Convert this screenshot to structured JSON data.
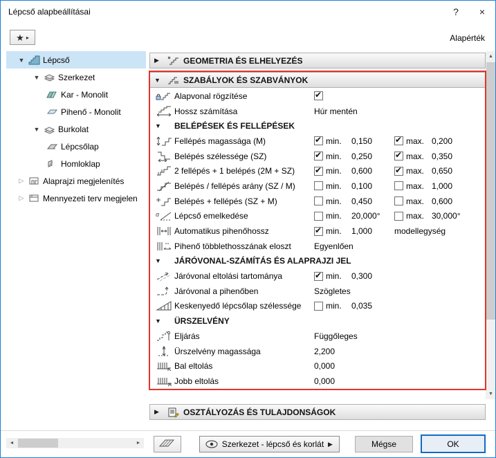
{
  "window": {
    "title": "Lépcső alapbeállításai",
    "default_label": "Alapérték"
  },
  "icons": {
    "help": "?",
    "close": "×",
    "favorites_star": "★",
    "favorites_arrow": "▸",
    "tree_expanded": "▼",
    "tree_collapsed": "▷",
    "section_expanded": "▼",
    "section_collapsed": "▶",
    "subsection_expanded": "▼",
    "scroll_up": "▲",
    "scroll_down": "▼",
    "scroll_left": "◄",
    "scroll_right": "►",
    "dropdown_arrow": "▶"
  },
  "tree": {
    "items": [
      {
        "label": "Lépcső",
        "level": 0,
        "arrow": "expanded",
        "icon": "stair-icon",
        "selected": true
      },
      {
        "label": "Szerkezet",
        "level": 1,
        "arrow": "expanded",
        "icon": "structure-icon",
        "selected": false
      },
      {
        "label": "Kar - Monolit",
        "level": 2,
        "arrow": "none",
        "icon": "flight-icon",
        "selected": false
      },
      {
        "label": "Pihenő - Monolit",
        "level": 2,
        "arrow": "none",
        "icon": "landing-icon",
        "selected": false
      },
      {
        "label": "Burkolat",
        "level": 1,
        "arrow": "expanded",
        "icon": "finish-icon",
        "selected": false
      },
      {
        "label": "Lépcsőlap",
        "level": 2,
        "arrow": "none",
        "icon": "tread-icon",
        "selected": false
      },
      {
        "label": "Homloklap",
        "level": 2,
        "arrow": "none",
        "icon": "riser-icon",
        "selected": false
      },
      {
        "label": "Alaprajzi megjelenítés",
        "level": 0,
        "arrow": "collapsed",
        "icon": "floorplan-icon",
        "selected": false
      },
      {
        "label": "Mennyezeti terv megjelen",
        "level": 0,
        "arrow": "collapsed",
        "icon": "ceiling-icon",
        "selected": false
      }
    ]
  },
  "sections": {
    "geometry": "GEOMETRIA ÉS ELHELYEZÉS",
    "rules": "SZABÁLYOK ÉS SZABVÁNYOK",
    "classification": "OSZTÁLYOZÁS ÉS TULAJDONSÁGOK"
  },
  "labels": {
    "min": "min.",
    "max": "max."
  },
  "rules_rows": [
    {
      "kind": "check",
      "icon": "baseline-lock-icon",
      "label": "Alapvonal rögzítése",
      "checked": true
    },
    {
      "kind": "value",
      "icon": "length-calc-icon",
      "label": "Hossz számítása",
      "value": "Húr mentén"
    },
    {
      "kind": "subheader",
      "label": "BELÉPÉSEK ÉS FELLÉPÉSEK"
    },
    {
      "kind": "minmax",
      "icon": "riser-height-icon",
      "label": "Fellépés magassága (M)",
      "min_checked": true,
      "min": "0,150",
      "max_checked": true,
      "max": "0,200"
    },
    {
      "kind": "minmax",
      "icon": "tread-width-icon",
      "label": "Belépés szélessége (SZ)",
      "min_checked": true,
      "min": "0,250",
      "max_checked": true,
      "max": "0,350"
    },
    {
      "kind": "minmax",
      "icon": "rule-2r1t-icon",
      "label": "2 fellépés + 1 belépés (2M + SZ)",
      "min_checked": true,
      "min": "0,600",
      "max_checked": true,
      "max": "0,650"
    },
    {
      "kind": "minmax",
      "icon": "ratio-icon",
      "label": "Belépés / fellépés arány (SZ / M)",
      "min_checked": false,
      "min": "0,100",
      "max_checked": false,
      "max": "1,000"
    },
    {
      "kind": "minmax",
      "icon": "sum-icon",
      "label": "Belépés + fellépés (SZ + M)",
      "min_checked": false,
      "min": "0,450",
      "max_checked": false,
      "max": "0,600"
    },
    {
      "kind": "minmax",
      "icon": "slope-icon",
      "label": "Lépcső emelkedése",
      "min_checked": false,
      "min": "20,000°",
      "max_checked": false,
      "max": "30,000°"
    },
    {
      "kind": "minextra",
      "icon": "auto-landing-icon",
      "label": "Automatikus pihenőhossz",
      "min_checked": true,
      "min": "1,000",
      "extra": "modellegység"
    },
    {
      "kind": "value",
      "icon": "landing-dist-icon",
      "label": "Pihenő többlethosszának eloszt",
      "value": "Egyenlően"
    },
    {
      "kind": "subheader",
      "label": "JÁRÓVONAL-SZÁMÍTÁS ÉS ALAPRAJZI JEL"
    },
    {
      "kind": "minextra",
      "icon": "walkline-offset-icon",
      "label": "Járóvonal eltolási tartománya",
      "min_checked": true,
      "min": "0,300",
      "extra": ""
    },
    {
      "kind": "value",
      "icon": "walkline-landing-icon",
      "label": "Járóvonal a pihenőben",
      "value": "Szögletes"
    },
    {
      "kind": "minextra",
      "icon": "tapered-tread-icon",
      "label": "Keskenyedő lépcsőlap szélessége",
      "min_checked": false,
      "min": "0,035",
      "extra": ""
    },
    {
      "kind": "subheader",
      "label": "ÜRSZELVÉNY"
    },
    {
      "kind": "value",
      "icon": "headroom-method-icon",
      "label": "Eljárás",
      "value": "Függőleges"
    },
    {
      "kind": "value",
      "icon": "headroom-height-icon",
      "label": "Ürszelvény magassága",
      "value": "2,200"
    },
    {
      "kind": "value",
      "icon": "left-offset-icon",
      "label": "Bal eltolás",
      "value": "0,000"
    },
    {
      "kind": "value",
      "icon": "right-offset-icon",
      "label": "Jobb eltolás",
      "value": "0,000"
    }
  ],
  "footer": {
    "preview": "Szerkezet - lépcső és korlát",
    "cancel": "Mégse",
    "ok": "OK"
  }
}
